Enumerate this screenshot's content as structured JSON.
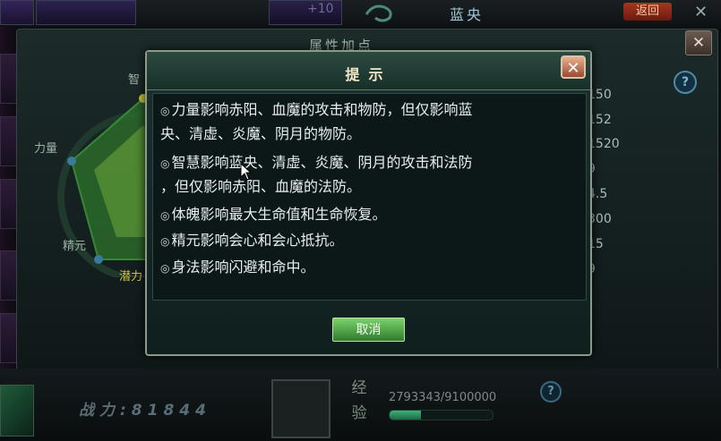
{
  "top_bar": {
    "plus_text": "+10",
    "emblem_icon": "swirl-emblem-icon",
    "character_name": "蓝央",
    "badge_text": "返回",
    "close_glyph": "✕"
  },
  "attribute_panel": {
    "title": "属性加点",
    "close_glyph": "✕",
    "help_glyph": "?",
    "radar_labels": {
      "strength": "力量",
      "wisdom": "智",
      "essence": "精元",
      "potential": "潜力"
    },
    "stats": [
      "150",
      "152",
      "1520",
      "9",
      "4.5",
      "300",
      "15",
      "9"
    ]
  },
  "dialog": {
    "title": "提示",
    "close_glyph": "✕",
    "bullet_icon": "◎",
    "lines": [
      "力量影响赤阳、血魔的攻击和物防，但仅影响蓝",
      "央、清虚、炎魔、阴月的物防。",
      "智慧影响蓝央、清虚、炎魔、阴月的攻击和法防",
      "，但仅影响赤阳、血魔的法防。",
      "体魄影响最大生命值和生命恢复。",
      "精元影响会心和会心抵抗。",
      "身法影响闪避和命中。"
    ],
    "cancel_label": "取消"
  },
  "bottom_bar": {
    "power_label": "战力:81844",
    "exp_label_top": "经",
    "exp_label_bottom": "验",
    "exp_value": "2793343/9100000",
    "exp_progress": 0.307,
    "help_glyph": "?"
  },
  "colors": {
    "dialog_border": "#8c9a88",
    "dialog_bg": "#0c1818",
    "button_green": "#4fa64a",
    "close_orange": "#c7704c",
    "potential_yellow": "#d4c23a"
  }
}
